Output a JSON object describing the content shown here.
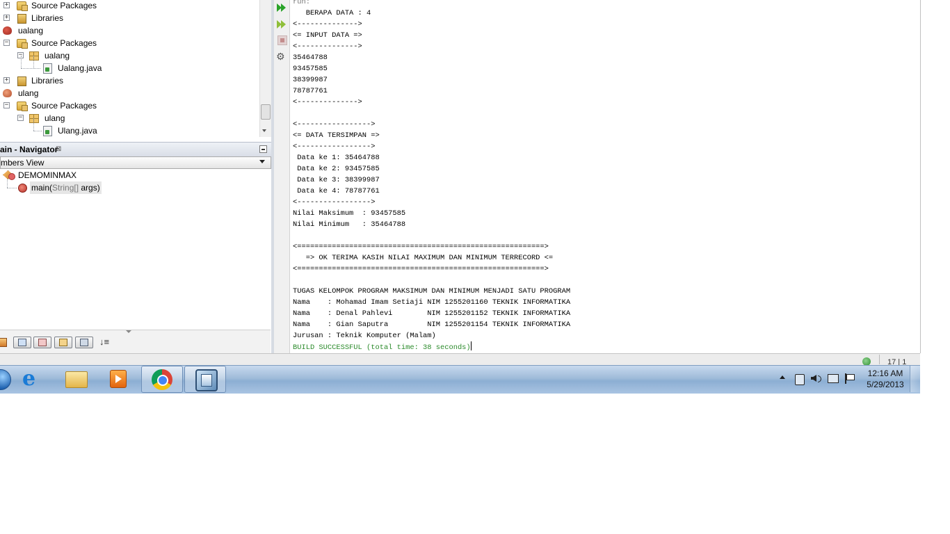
{
  "projects_tree": {
    "rows": [
      {
        "label": "Source Packages"
      },
      {
        "label": "Libraries"
      },
      {
        "label": "ualang"
      },
      {
        "label": "Source Packages"
      },
      {
        "label": "ualang"
      },
      {
        "label": "Ualang.java"
      },
      {
        "label": "Libraries"
      },
      {
        "label": "ulang"
      },
      {
        "label": "Source Packages"
      },
      {
        "label": "ulang"
      },
      {
        "label": "Ulang.java"
      }
    ]
  },
  "navigator": {
    "title": "ain - Navigator",
    "close_glyph": "⊠",
    "view_select": "mbers View",
    "items": [
      {
        "label": "DEMOMINMAX"
      },
      {
        "label": "main(",
        "label_params": "String[]",
        "label_tail": " args)"
      }
    ],
    "sort_glyph": "↓≡"
  },
  "output": {
    "lines": [
      "run:",
      "   BERAPA DATA : 4",
      "<-------------->",
      "<= INPUT DATA =>",
      "<-------------->",
      "35464788",
      "93457585",
      "38399987",
      "78787761",
      "<-------------->",
      "",
      "<----------------->",
      "<= DATA TERSIMPAN =>",
      "<----------------->",
      " Data ke 1: 35464788",
      " Data ke 2: 93457585",
      " Data ke 3: 38399987",
      " Data ke 4: 78787761",
      "<----------------->",
      "Nilai Maksimum  : 93457585",
      "Nilai Minimum   : 35464788",
      "",
      "<=========================================================>",
      "   => OK TERIMA KASIH NILAI MAXIMUM DAN MINIMUM TERRECORD <=",
      "<=========================================================>",
      "",
      "TUGAS KELOMPOK PROGRAM MAKSIMUM DAN MINIMUM MENJADI SATU PROGRAM",
      "Nama    : Mohamad Imam Setiaji NIM 1255201160 TEKNIK INFORMATIKA",
      "Nama    : Denal Pahlevi        NIM 1255201152 TEKNIK INFORMATIKA",
      "Nama    : Gian Saputra         NIM 1255201154 TEKNIK INFORMATIKA",
      "Jurusan : Teknik Komputer (Malam)"
    ],
    "build_line": "BUILD SUCCESSFUL (total time: 38 seconds)",
    "build_color": "#2a8a2a"
  },
  "status_bar": {
    "position": "17 | 1"
  },
  "taskbar": {
    "apps": [
      {
        "icon": "internet-explorer-icon"
      },
      {
        "icon": "file-explorer-icon"
      },
      {
        "icon": "media-player-icon"
      },
      {
        "icon": "chrome-icon"
      },
      {
        "icon": "netbeans-icon"
      }
    ],
    "tray_icons": [
      "show-hidden-icons-icon",
      "power-icon",
      "volume-icon",
      "network-icon",
      "action-center-flag-icon"
    ],
    "clock_time": "12:16 AM",
    "clock_date": "5/29/2013"
  }
}
